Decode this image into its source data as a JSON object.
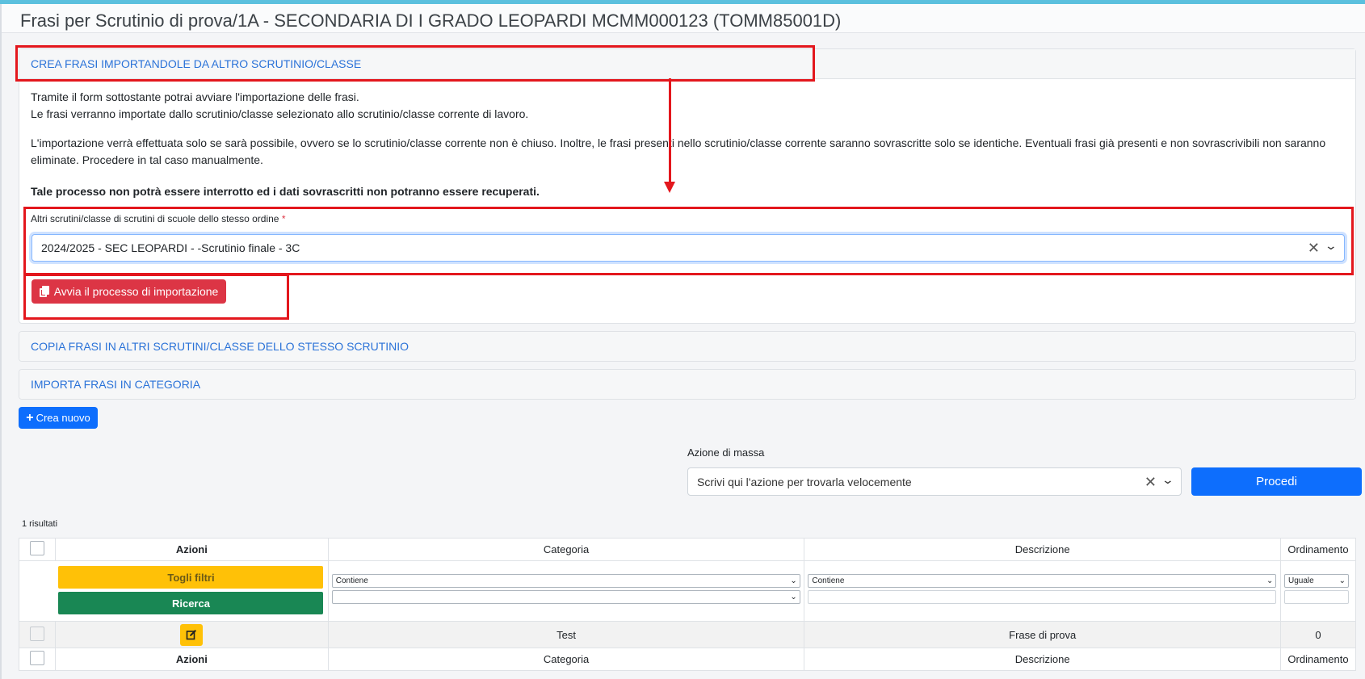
{
  "page": {
    "title": "Frasi per Scrutinio di prova/1A - SECONDARIA DI I GRADO LEOPARDI MCMM000123 (TOMM85001D)"
  },
  "import_panel": {
    "header": "CREA FRASI IMPORTANDOLE DA ALTRO SCRUTINIO/CLASSE",
    "intro_line1": "Tramite il form sottostante potrai avviare l'importazione delle frasi.",
    "intro_line2": "Le frasi verranno importate dallo scrutinio/classe selezionato allo scrutinio/classe corrente di lavoro.",
    "info": "L'importazione verrà effettuata solo se sarà possibile, ovvero se lo scrutinio/classe corrente non è chiuso. Inoltre, le frasi presenti nello scrutinio/classe corrente saranno sovrascritte solo se identiche. Eventuali frasi già presenti e non sovrascrivibili non saranno eliminate. Procedere in tal caso manualmente.",
    "warning": "Tale processo non potrà essere interrotto ed i dati sovrascritti non potranno essere recuperati.",
    "select_label": "Altri scrutini/classe di scrutini di scuole dello stesso ordine",
    "required_mark": "*",
    "select_value": "2024/2025 - SEC LEOPARDI - -Scrutinio finale - 3C",
    "start_button": "Avvia il processo di importazione"
  },
  "copy_panel": {
    "header": "COPIA FRASI IN ALTRI SCRUTINI/CLASSE DELLO STESSO SCRUTINIO"
  },
  "category_panel": {
    "header": "IMPORTA FRASI IN CATEGORIA"
  },
  "create_button": "Crea nuovo",
  "mass_action": {
    "label": "Azione di massa",
    "placeholder": "Scrivi qui l'azione per trovarla velocemente",
    "button": "Procedi"
  },
  "results": "1 risultati",
  "table": {
    "columns": [
      "Azioni",
      "Categoria",
      "Descrizione",
      "Ordinamento"
    ],
    "filters": {
      "clear_button": "Togli filtri",
      "search_button": "Ricerca",
      "categoria_op": "Contiene",
      "descrizione_op": "Contiene",
      "ordinamento_op": "Uguale"
    },
    "rows": [
      {
        "categoria": "Test",
        "descrizione": "Frase di prova",
        "ordinamento": "0"
      }
    ]
  },
  "colors": {
    "accent": "#0d6efd",
    "danger": "#dc3545",
    "warning": "#ffc107",
    "success": "#198754",
    "annotation": "#e3171d"
  }
}
